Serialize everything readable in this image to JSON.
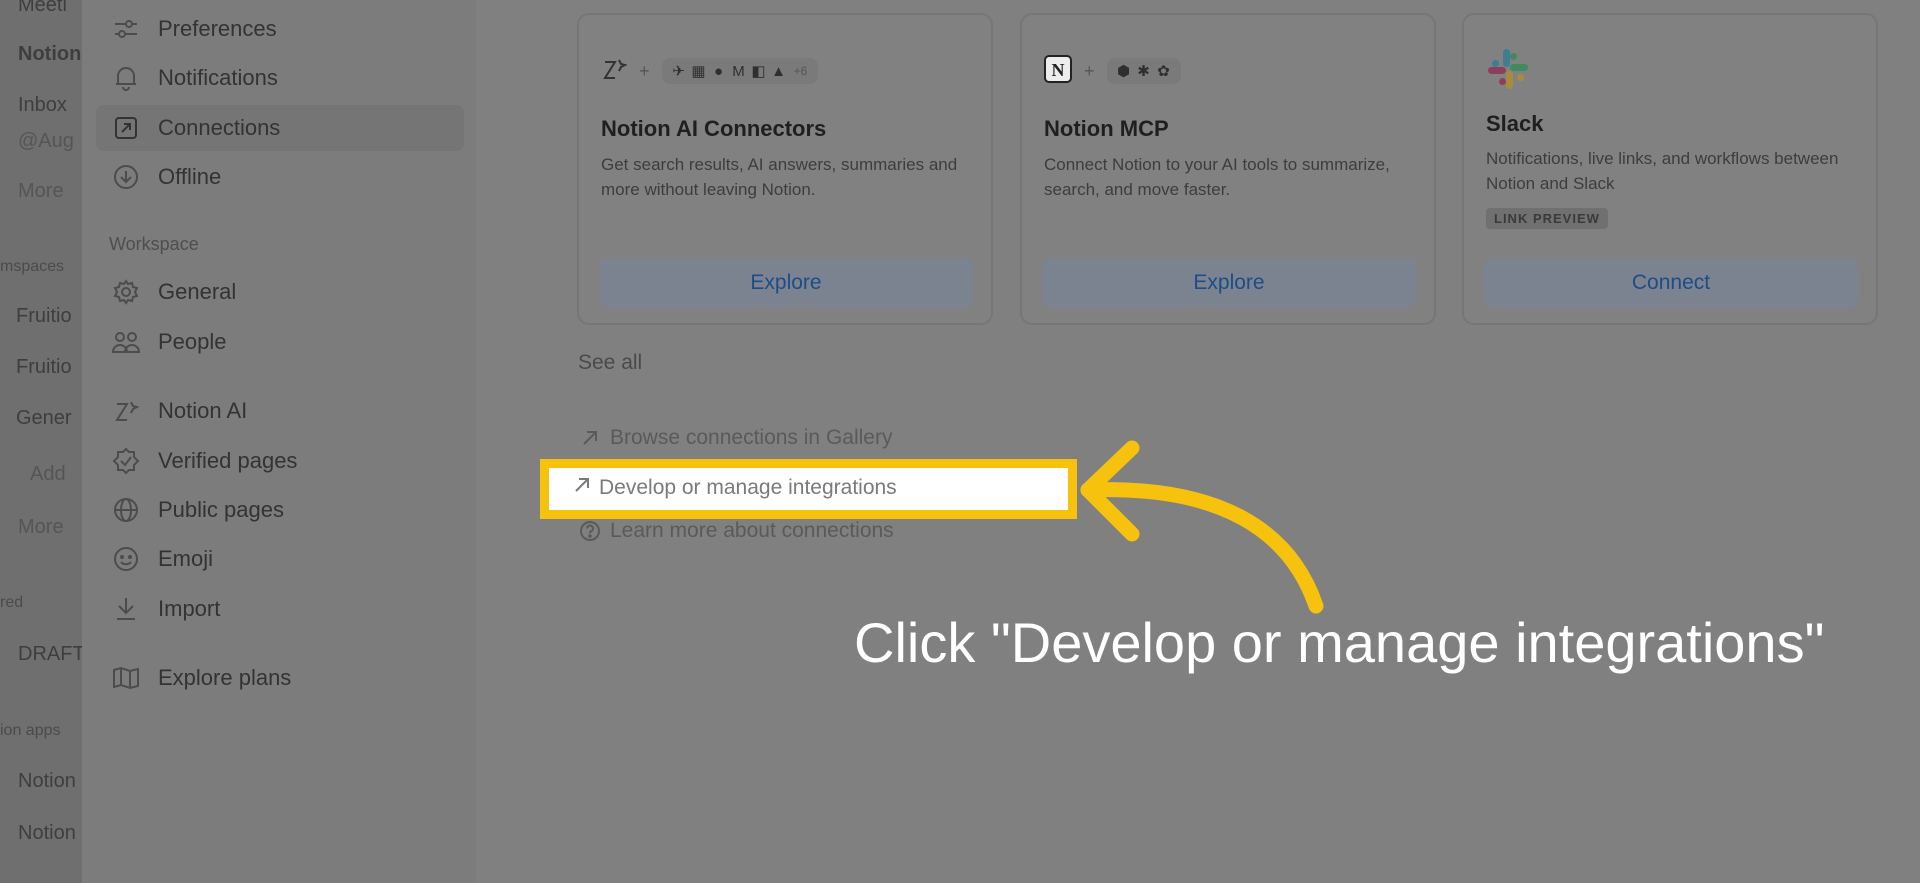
{
  "app_sidebar": {
    "items": [
      "Meeti",
      "Notion",
      "Inbox",
      "@Aug",
      "More",
      "mspaces",
      "Fruitio",
      "Fruitio",
      "Gener",
      "Add",
      "More",
      "red",
      "DRAFT",
      "ion apps",
      "Notion",
      "Notion"
    ]
  },
  "settings_nav": {
    "items": [
      {
        "label": "Preferences",
        "icon": "sliders-icon"
      },
      {
        "label": "Notifications",
        "icon": "bell-icon"
      },
      {
        "label": "Connections",
        "icon": "external-link-icon",
        "active": true
      },
      {
        "label": "Offline",
        "icon": "download-circle-icon"
      }
    ],
    "workspace_heading": "Workspace",
    "workspace_items": [
      {
        "label": "General",
        "icon": "gear-icon"
      },
      {
        "label": "People",
        "icon": "people-icon"
      },
      {
        "label": "Notion AI",
        "icon": "notion-ai-icon"
      },
      {
        "label": "Verified pages",
        "icon": "verified-badge-icon"
      },
      {
        "label": "Public pages",
        "icon": "globe-icon"
      },
      {
        "label": "Emoji",
        "icon": "smiley-icon"
      },
      {
        "label": "Import",
        "icon": "import-icon"
      },
      {
        "label": "Explore plans",
        "icon": "map-icon"
      }
    ]
  },
  "cards": [
    {
      "title": "Notion AI Connectors",
      "description": "Get search results, AI answers, summaries and more without leaving Notion.",
      "more_count": "+6",
      "button": "Explore"
    },
    {
      "title": "Notion MCP",
      "description": "Connect Notion to your AI tools to summarize, search, and move faster.",
      "button": "Explore"
    },
    {
      "title": "Slack",
      "description": "Notifications, live links, and workflows between Notion and Slack",
      "badge": "LINK PREVIEW",
      "button": "Connect"
    }
  ],
  "see_all": "See all",
  "links": {
    "browse": "Browse connections in Gallery",
    "develop": "Develop or manage integrations",
    "learn": "Learn more about connections"
  },
  "annotation": {
    "instruction": "Click \"Develop or manage integrations\"",
    "highlight_color": "#f6c20e"
  }
}
